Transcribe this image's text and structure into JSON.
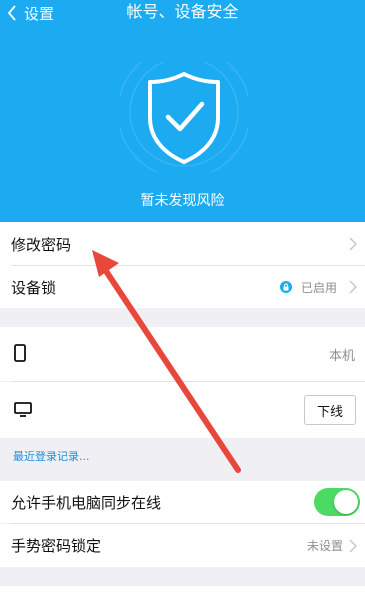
{
  "nav": {
    "back_label": "设置",
    "title": "帐号、设备安全"
  },
  "header": {
    "status": "暂未发现风险",
    "bg_color": "#1cabf1",
    "shield_icon": "shield-check-icon"
  },
  "items": {
    "change_password": "修改密码",
    "device_lock": "设备锁",
    "device_lock_status": "已启用",
    "current_device": "本机",
    "offline_button": "下线",
    "recent_logins": "最近登录记录...",
    "sync_online": "允许手机电脑同步在线",
    "sync_online_enabled": true,
    "gesture_lock": "手势密码锁定",
    "gesture_lock_status": "未设置"
  },
  "colors": {
    "accent": "#1cabf1",
    "toggle_on": "#4cd964",
    "link": "#1b8fe0",
    "annotation_arrow": "#e8473c"
  }
}
